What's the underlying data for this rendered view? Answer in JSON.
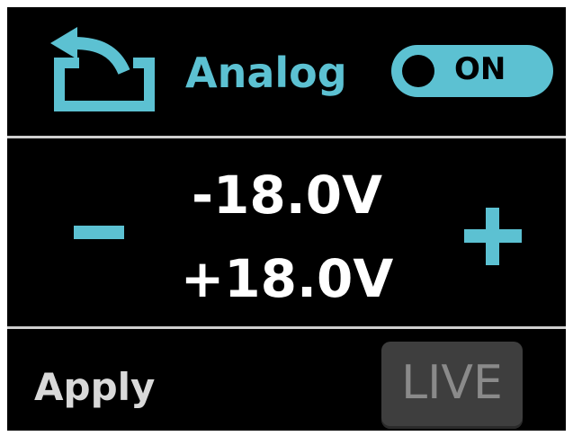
{
  "header": {
    "title": "Analog",
    "toggle_label": "ON",
    "back_icon": "back-arrow-icon"
  },
  "controls": {
    "negative_voltage": "-18.0V",
    "positive_voltage": "+18.0V",
    "decrement_icon": "minus-icon",
    "increment_icon": "plus-icon"
  },
  "footer": {
    "apply_label": "Apply",
    "live_label": "LIVE"
  },
  "colors": {
    "accent": "#5cc1d2",
    "background": "#000000",
    "text": "#ffffff",
    "divider": "#cfcfcf",
    "live_button": "#3e3e3e"
  }
}
